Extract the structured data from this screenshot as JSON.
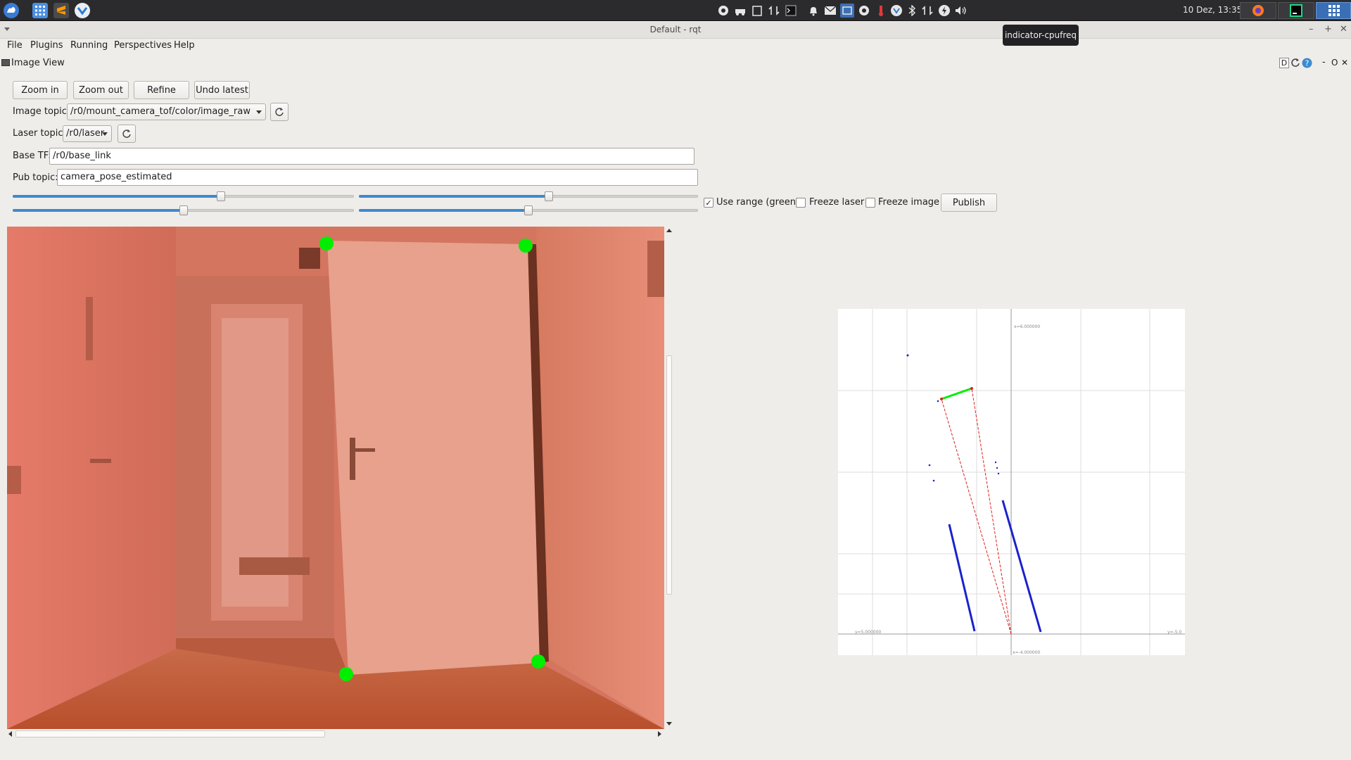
{
  "panel": {
    "clock": "10 Dez, 13:35",
    "tooltip": "indicator-cpufreq"
  },
  "window": {
    "title": "Default - rqt",
    "min_glyph": "–",
    "max_glyph": "+",
    "close_glyph": "✕"
  },
  "menu": {
    "file": "File",
    "plugins": "Plugins",
    "running": "Running",
    "perspectives": "Perspectives",
    "help": "Help"
  },
  "dock": {
    "title": "Image View",
    "d_label": "D",
    "minus": "-",
    "o_label": "O",
    "close": "✕"
  },
  "toolbar": {
    "zoom_in": "Zoom in",
    "zoom_out": "Zoom out",
    "refine": "Refine",
    "undo_latest": "Undo latest"
  },
  "form": {
    "image_topic_label": "Image topic:",
    "image_topic_value": "/r0/mount_camera_tof/color/image_raw",
    "laser_topic_label": "Laser topic:",
    "laser_topic_value": "/r0/laser",
    "base_tf_label": "Base TF:",
    "base_tf_value": "/r0/base_link",
    "pub_topic_label": "Pub topic:",
    "pub_topic_value": "camera_pose_estimated"
  },
  "sliders": [
    {
      "value": 0.61
    },
    {
      "value": 0.56
    },
    {
      "value": 0.5
    },
    {
      "value": 0.5
    }
  ],
  "options": {
    "use_range_label": "Use range (green)",
    "use_range_checked": true,
    "freeze_laser_label": "Freeze laser",
    "freeze_laser_checked": false,
    "freeze_image_label": "Freeze image",
    "freeze_image_checked": false,
    "publish_label": "Publish"
  },
  "plot": {
    "top_label": "x=6.000000",
    "left_label": "y=5.000000",
    "right_label": "y=-5.0",
    "bottom_label": "x=-4.000000"
  },
  "colors": {
    "accent": "#3d8ad1",
    "marker_green": "#00ee00",
    "laser_blue": "#1a22cc",
    "ray_red": "#e02020"
  }
}
